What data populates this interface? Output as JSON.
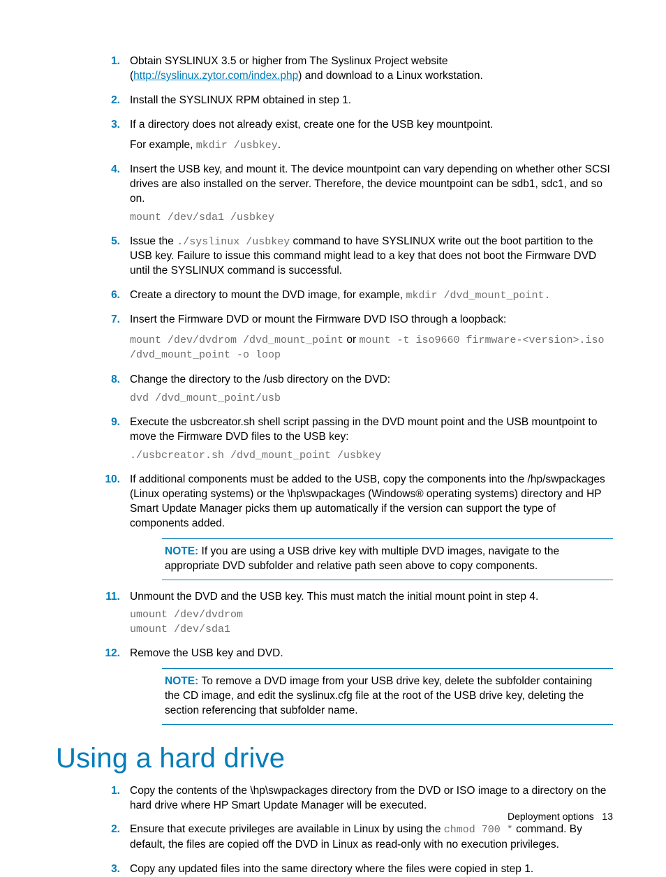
{
  "steps_a": [
    {
      "n": "1.",
      "parts": [
        {
          "t": "text",
          "v": "Obtain SYSLINUX 3.5 or higher from The Syslinux Project website ("
        },
        {
          "t": "link",
          "v": "http://syslinux.zytor.com/index.php"
        },
        {
          "t": "text",
          "v": ") and download to a Linux workstation."
        }
      ]
    },
    {
      "n": "2.",
      "parts": [
        {
          "t": "text",
          "v": "Install the SYSLINUX RPM obtained in step 1."
        }
      ]
    },
    {
      "n": "3.",
      "parts": [
        {
          "t": "text",
          "v": "If a directory does not already exist, create one for the USB key mountpoint."
        }
      ],
      "sub": [
        {
          "t": "mixed",
          "v": [
            {
              "t": "text",
              "v": "For example, "
            },
            {
              "t": "mono",
              "v": "mkdir /usbkey"
            },
            {
              "t": "text",
              "v": "."
            }
          ]
        }
      ]
    },
    {
      "n": "4.",
      "parts": [
        {
          "t": "text",
          "v": "Insert the USB key, and mount it. The device mountpoint can vary depending on whether other SCSI drives are also installed on the server. Therefore, the device mountpoint can be sdb1, sdc1, and so on."
        }
      ],
      "sub": [
        {
          "t": "code",
          "v": [
            "mount /dev/sda1 /usbkey"
          ]
        }
      ]
    },
    {
      "n": "5.",
      "parts": [
        {
          "t": "text",
          "v": "Issue the "
        },
        {
          "t": "mono",
          "v": "./syslinux /usbkey"
        },
        {
          "t": "text",
          "v": " command to have SYSLINUX write out the boot partition to the USB key. Failure to issue this command might lead to a key that does not boot the Firmware DVD until the SYSLINUX command is successful."
        }
      ]
    },
    {
      "n": "6.",
      "parts": [
        {
          "t": "text",
          "v": "Create a directory to mount the DVD image, for example, "
        },
        {
          "t": "mono",
          "v": "mkdir /dvd_mount_point."
        }
      ]
    },
    {
      "n": "7.",
      "parts": [
        {
          "t": "text",
          "v": "Insert the Firmware DVD or mount the Firmware DVD ISO through a loopback:"
        }
      ],
      "sub": [
        {
          "t": "mixed",
          "v": [
            {
              "t": "mono",
              "v": "mount /dev/dvdrom /dvd_mount_point"
            },
            {
              "t": "text",
              "v": " or "
            },
            {
              "t": "mono",
              "v": "mount -t iso9660 firmware-<version>.iso /dvd_mount_point -o loop"
            }
          ]
        }
      ]
    },
    {
      "n": "8.",
      "parts": [
        {
          "t": "text",
          "v": "Change the directory to the /usb directory on the DVD:"
        }
      ],
      "sub": [
        {
          "t": "code",
          "v": [
            "dvd /dvd_mount_point/usb"
          ]
        }
      ]
    },
    {
      "n": "9.",
      "parts": [
        {
          "t": "text",
          "v": "Execute the usbcreator.sh shell script passing in the DVD mount point and the USB mountpoint to move the Firmware DVD files to the USB key:"
        }
      ],
      "sub": [
        {
          "t": "code",
          "v": [
            "./usbcreator.sh /dvd_mount_point /usbkey"
          ]
        }
      ]
    },
    {
      "n": "10.",
      "parts": [
        {
          "t": "text",
          "v": "If additional components must be added to the USB, copy the components into the /hp/swpackages (Linux operating systems) or the \\hp\\swpackages (Windows® operating systems) directory and HP Smart Update Manager picks them up automatically if the version can support the type of components added."
        }
      ],
      "note": {
        "label": "NOTE:  ",
        "text": "If you are using a USB drive key with multiple DVD images, navigate to the appropriate DVD subfolder and relative path seen above to copy components."
      }
    },
    {
      "n": "11.",
      "parts": [
        {
          "t": "text",
          "v": "Unmount the DVD and the USB key. This must match the initial mount point in step 4."
        }
      ],
      "sub": [
        {
          "t": "code",
          "v": [
            "umount /dev/dvdrom",
            "umount /dev/sda1"
          ]
        }
      ]
    },
    {
      "n": "12.",
      "parts": [
        {
          "t": "text",
          "v": "Remove the USB key and DVD."
        }
      ],
      "note": {
        "label": "NOTE:  ",
        "text": "To remove a DVD image from your USB drive key, delete the subfolder containing the CD image, and edit the syslinux.cfg file at the root of the USB drive key, deleting the section referencing that subfolder name."
      }
    }
  ],
  "heading": "Using a hard drive",
  "steps_b": [
    {
      "n": "1.",
      "parts": [
        {
          "t": "text",
          "v": "Copy the contents of the \\hp\\swpackages directory from the DVD or ISO image to a directory on the hard drive where HP Smart Update Manager will be executed."
        }
      ]
    },
    {
      "n": "2.",
      "parts": [
        {
          "t": "text",
          "v": "Ensure that execute privileges are available in Linux by using the "
        },
        {
          "t": "mono",
          "v": "chmod 700 *"
        },
        {
          "t": "text",
          "v": " command. By default, the files are copied off the DVD in Linux as read-only with no execution privileges."
        }
      ]
    },
    {
      "n": "3.",
      "parts": [
        {
          "t": "text",
          "v": "Copy any updated files into the same directory where the files were copied in step 1."
        }
      ]
    }
  ],
  "footer": {
    "section": "Deployment options",
    "page": "13"
  }
}
